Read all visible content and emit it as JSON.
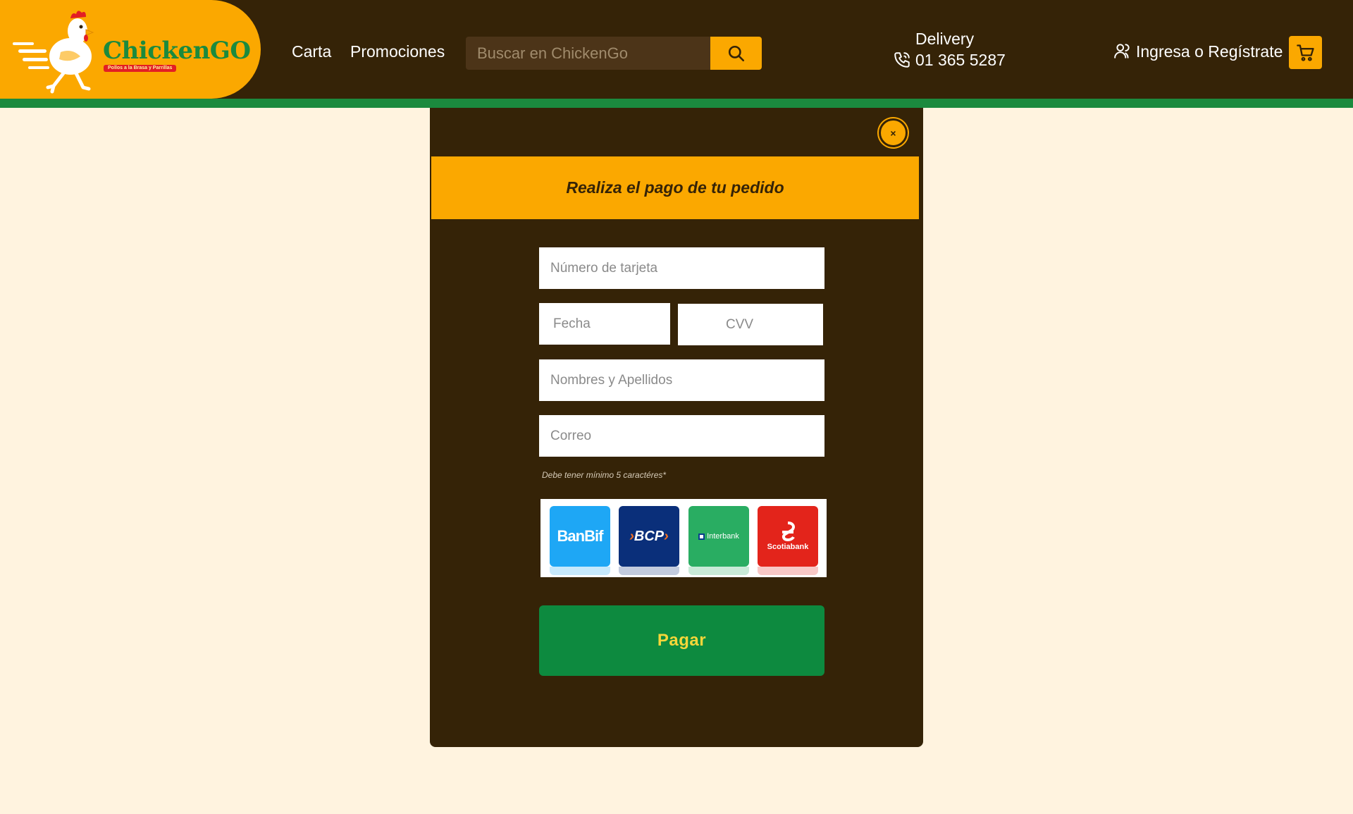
{
  "brand": {
    "name": "ChickenGO",
    "tagline": "Pollos a la Brasa y Parrillas"
  },
  "nav": {
    "items": [
      {
        "label": "Carta"
      },
      {
        "label": "Promociones"
      }
    ]
  },
  "search": {
    "placeholder": "Buscar en ChickenGo",
    "value": ""
  },
  "delivery": {
    "label": "Delivery",
    "phone": "01 365 5287"
  },
  "account": {
    "login_label": "Ingresa o Regístrate"
  },
  "modal": {
    "title": "Realiza el pago de tu pedido",
    "close_symbol": "×",
    "fields": {
      "card_number": {
        "placeholder": "Número de tarjeta",
        "value": ""
      },
      "date": {
        "placeholder": "Fecha",
        "value": ""
      },
      "cvv": {
        "placeholder": "CVV",
        "value": ""
      },
      "full_name": {
        "placeholder": "Nombres y Apellidos",
        "value": ""
      },
      "email": {
        "placeholder": "Correo",
        "value": ""
      }
    },
    "hint": "Debe tener mínimo 5 caractéres*",
    "banks": [
      {
        "name": "BanBif",
        "color": "#1ea7f5"
      },
      {
        "name": "BCP",
        "color": "#0a2f7a"
      },
      {
        "name": "Interbank",
        "color": "#29ad62"
      },
      {
        "name": "Scotiabank",
        "color": "#e3241b"
      }
    ],
    "pay_label": "Pagar"
  },
  "colors": {
    "header_bg": "#352307",
    "accent": "#fba800",
    "green": "#1b8a3e",
    "page_bg": "#fff3df",
    "pay_text": "#f5d63a"
  },
  "icons": {
    "search": "search-icon",
    "phone": "phone-icon",
    "user": "user-icon",
    "cart": "cart-icon",
    "close": "close-icon"
  }
}
